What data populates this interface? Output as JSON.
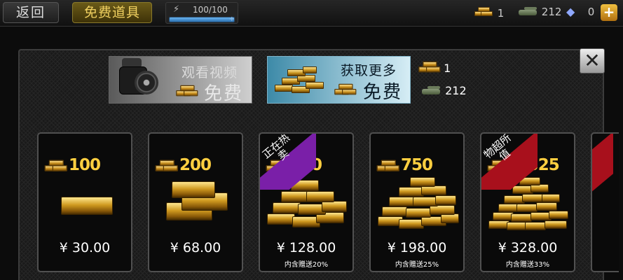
{
  "topbar": {
    "back_label": "返回",
    "free_items_label": "免费道具",
    "energy": {
      "text": "100/100",
      "fraction": 1.0
    },
    "gold_count": "1",
    "tank_count": "212",
    "gem_count": "0",
    "icons": [
      "lightning-icon",
      "gold-bars-icon",
      "tank-icon",
      "diamond-icon",
      "plus-icon"
    ]
  },
  "banners": {
    "video": {
      "title": "观看视频",
      "free": "免费"
    },
    "more": {
      "title": "获取更多",
      "free": "免费"
    }
  },
  "side_resources": {
    "gold": "1",
    "tanks": "212"
  },
  "cards": [
    {
      "amount": "100",
      "price": "¥  30.00",
      "bonus": "",
      "ribbon": ""
    },
    {
      "amount": "200",
      "price": "¥  68.00",
      "bonus": "",
      "ribbon": ""
    },
    {
      "amount": "480",
      "price": "¥  128.00",
      "bonus": "内含赠送20%",
      "ribbon": "正在热卖",
      "ribbon_color": "#7a1fa8"
    },
    {
      "amount": "750",
      "price": "¥  198.00",
      "bonus": "内含赠送25%",
      "ribbon": ""
    },
    {
      "amount": "1,325",
      "price": "¥  328.00",
      "bonus": "内含赠送33%",
      "ribbon": "物超所值",
      "ribbon_color": "#a8101c"
    }
  ],
  "colors": {
    "accent_gold": "#ffcf40",
    "hot_ribbon": "#7a1fa8",
    "value_ribbon": "#a8101c",
    "panel_bg": "#1a1a1a"
  }
}
